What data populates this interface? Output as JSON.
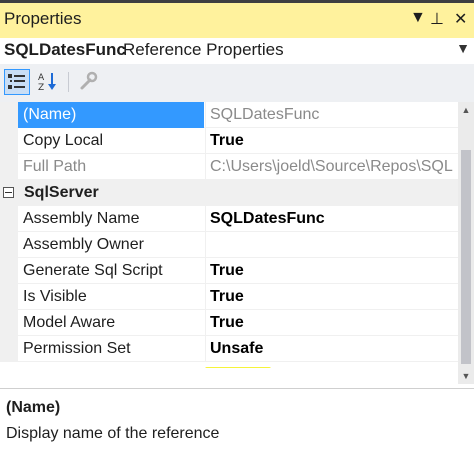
{
  "window": {
    "title": "Properties",
    "dropdown_glyph": "▼",
    "pin_glyph": "⊥",
    "close_glyph": "✕"
  },
  "object": {
    "name": "SQLDatesFunc",
    "type": "Reference Properties",
    "dropdown_glyph": "▼"
  },
  "toolbar": {
    "buttons": [
      {
        "name": "categorized-icon",
        "active": true
      },
      {
        "name": "alphabetical-icon",
        "active": false
      },
      {
        "name": "property-pages-icon",
        "active": false
      }
    ]
  },
  "properties": {
    "rows": [
      {
        "name": "(Name)",
        "value": "SQLDatesFunc",
        "selected": true,
        "value_style": "gray"
      },
      {
        "name": "Copy Local",
        "value": "True",
        "value_style": "bold"
      },
      {
        "name": "Full Path",
        "value": "C:\\Users\\joeld\\Source\\Repos\\SQL",
        "value_style": "gray",
        "name_style": "gray"
      }
    ],
    "category": {
      "name": "SqlServer",
      "toggle": "−"
    },
    "category_rows": [
      {
        "name": "Assembly Name",
        "value": "SQLDatesFunc",
        "value_style": "bold"
      },
      {
        "name": "Assembly Owner",
        "value": ""
      },
      {
        "name": "Generate Sql Script",
        "value": "True",
        "value_style": "bold"
      },
      {
        "name": "Is Visible",
        "value": "True",
        "value_style": "bold"
      },
      {
        "name": "Model Aware",
        "value": "True",
        "value_style": "bold"
      },
      {
        "name": "Permission Set",
        "value": "Unsafe",
        "value_style": "bold"
      }
    ]
  },
  "scrollbar": {
    "up_glyph": "▲",
    "down_glyph": "▼"
  },
  "description": {
    "name": "(Name)",
    "text": "Display name of the reference"
  },
  "colors": {
    "title_bg": "#fff29d",
    "selection": "#3399ff",
    "highlight": "#f6f43a"
  }
}
